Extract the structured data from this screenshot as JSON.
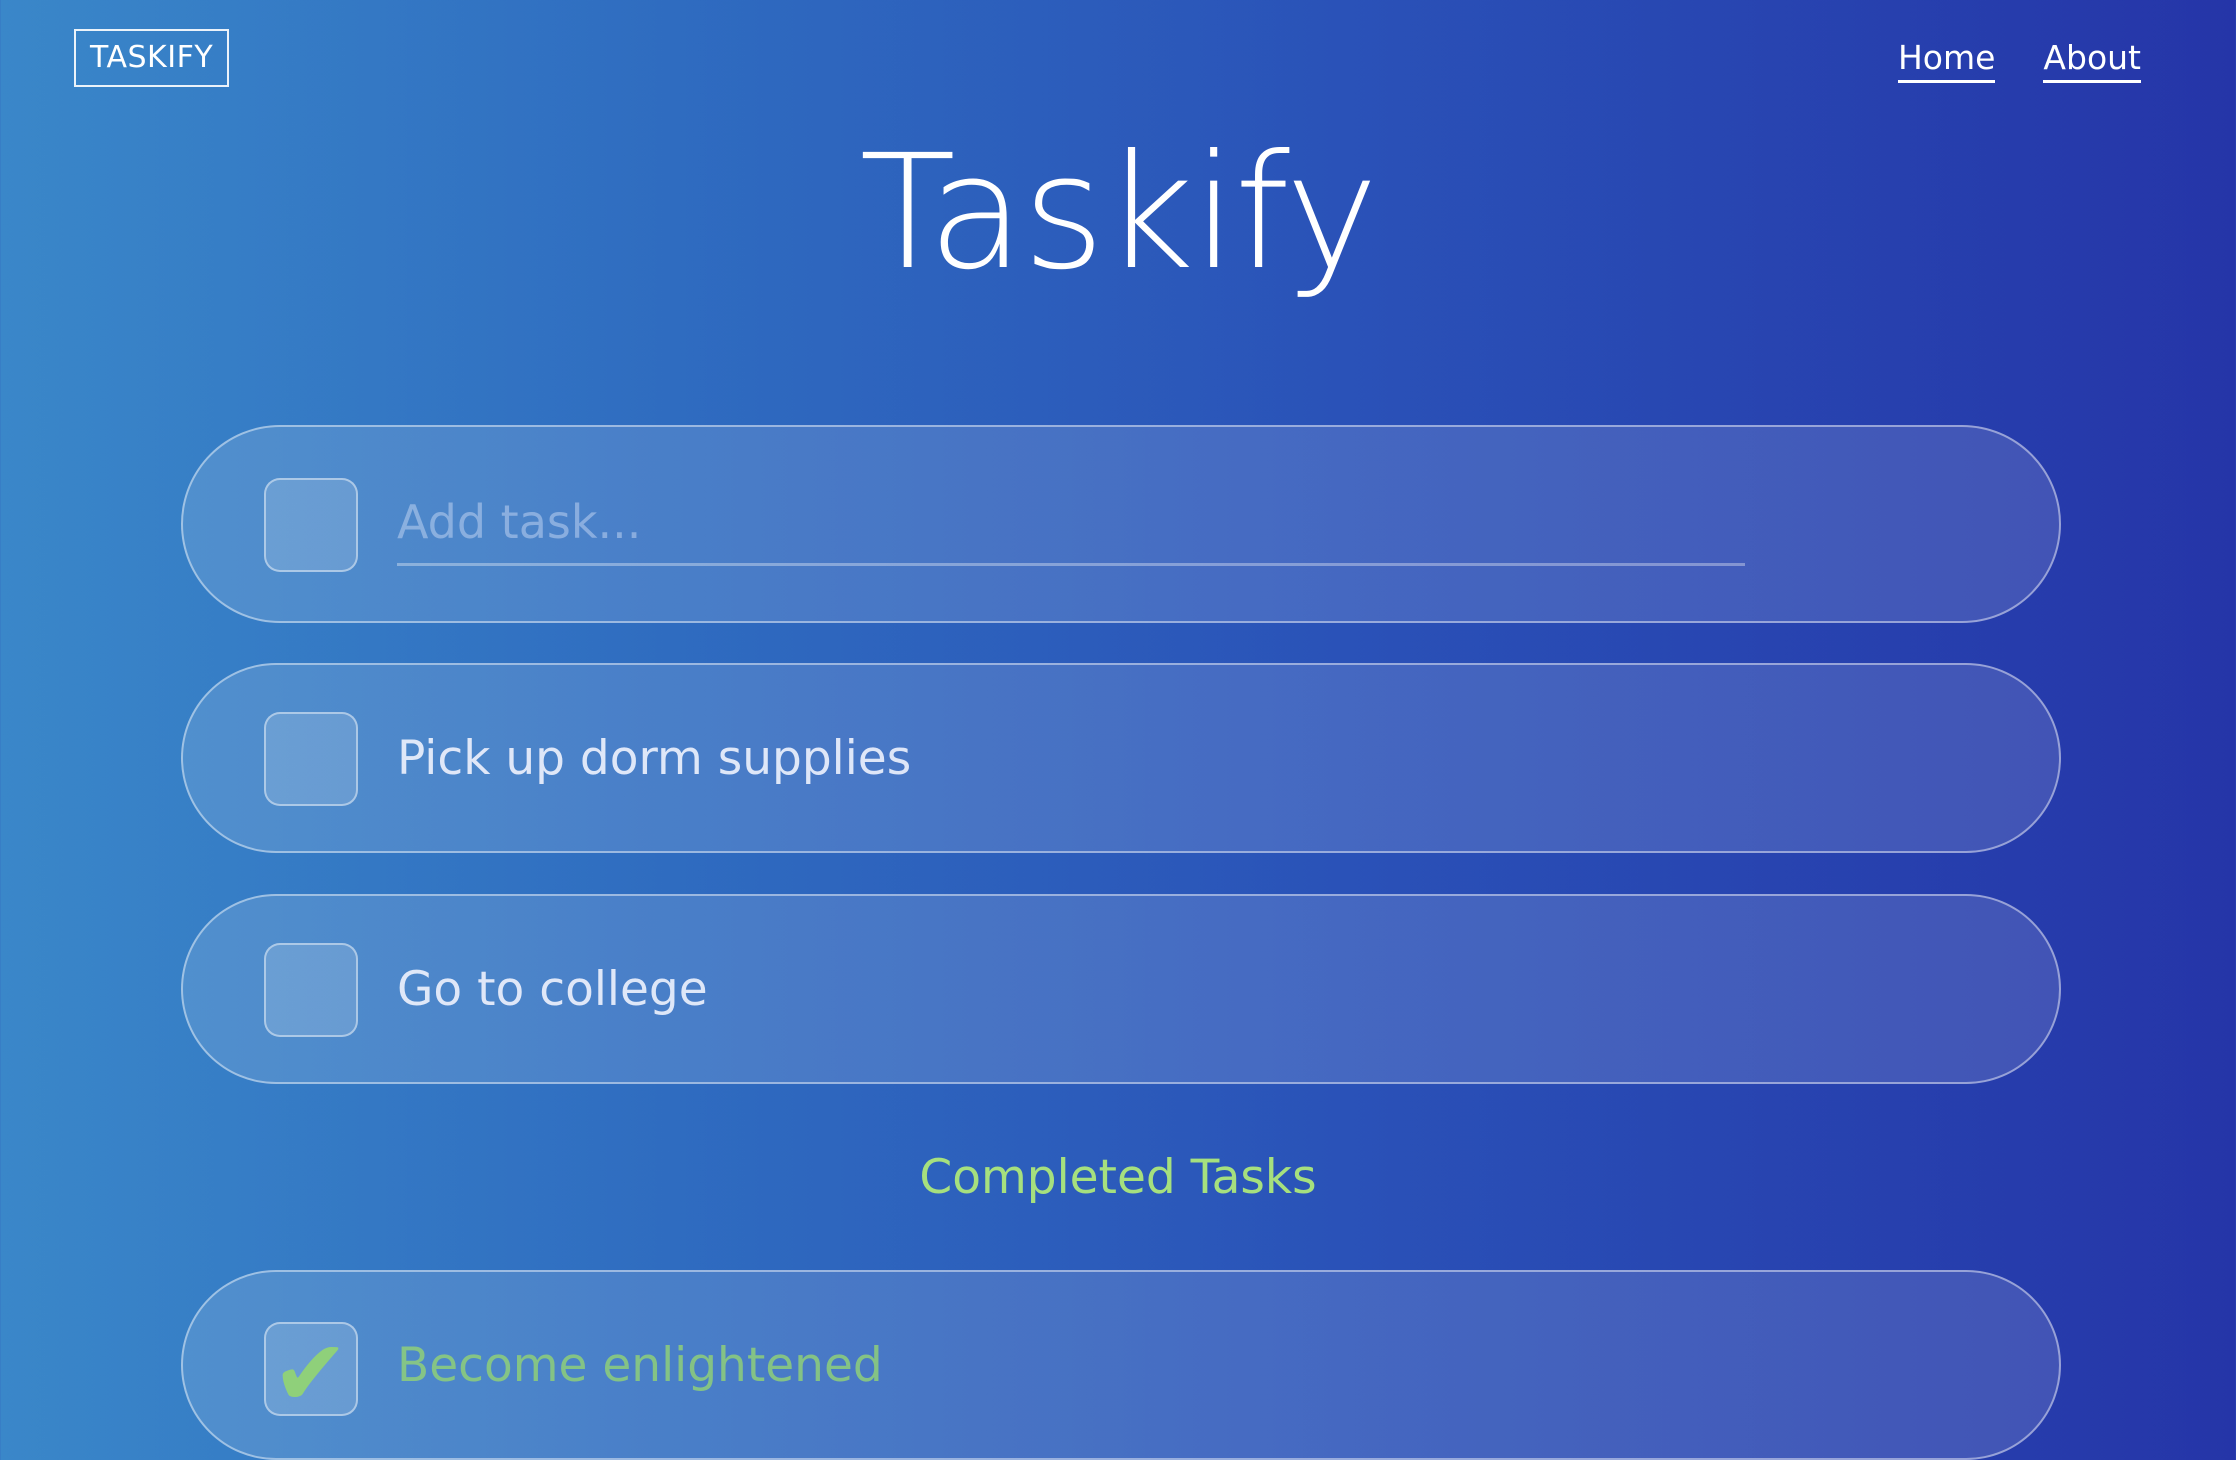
{
  "header": {
    "brand": "TASKIFY",
    "nav": [
      {
        "label": "Home"
      },
      {
        "label": "About"
      }
    ]
  },
  "page": {
    "title": "Taskify"
  },
  "add_task": {
    "placeholder": "Add task...",
    "value": ""
  },
  "tasks": [
    {
      "label": "Pick up dorm supplies",
      "completed": false
    },
    {
      "label": "Go to college",
      "completed": false
    }
  ],
  "completed_section": {
    "heading": "Completed Tasks",
    "tasks": [
      {
        "label": "Become enlightened",
        "completed": true,
        "icon": "check-icon"
      }
    ]
  },
  "colors": {
    "gradient_start": "#3a87c9",
    "gradient_end": "#2535a8",
    "completed_accent": "#a6e07e"
  }
}
